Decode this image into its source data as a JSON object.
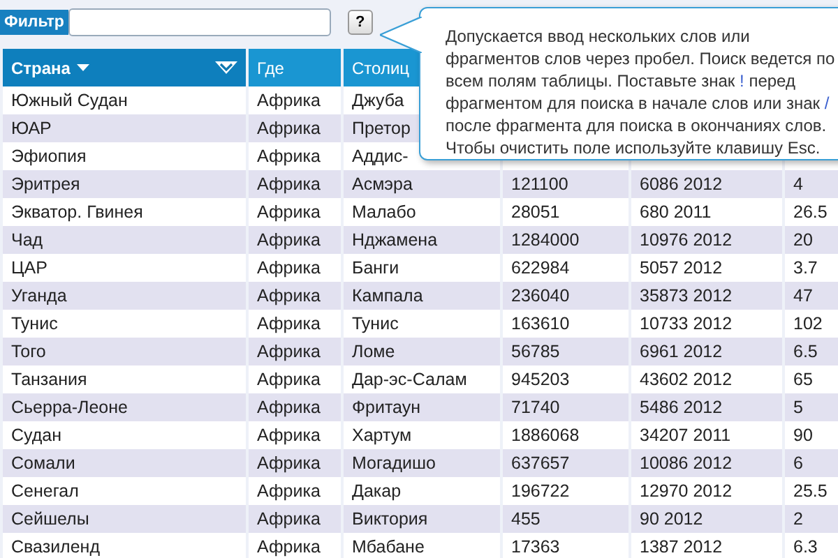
{
  "filter": {
    "label": "Фильтр",
    "help_button": "?"
  },
  "tooltip": {
    "parts": [
      {
        "kind": "plain",
        "text": "Допускается ввод нескольких слов или фрагментов слов через пробел. Поиск ведется по всем полям таблицы. Поставьте знак "
      },
      {
        "kind": "symbol",
        "text": "!"
      },
      {
        "kind": "plain",
        "text": " перед фрагментом для поиска в начале слов или знак "
      },
      {
        "kind": "symbol",
        "text": "/"
      },
      {
        "kind": "plain",
        "text": " после фрагмента для поиска в окончаниях слов. Чтобы очистить поле используйте клавишу Esc."
      }
    ]
  },
  "table": {
    "columns": [
      {
        "label": "Страна",
        "selected": true
      },
      {
        "label": "Где",
        "selected": false
      },
      {
        "label": "Столиц",
        "selected": false
      }
    ],
    "rows": [
      {
        "cells": [
          "Южный Судан",
          "Африка",
          "Джуба"
        ]
      },
      {
        "cells": [
          "ЮАР",
          "Африка",
          "Претор"
        ]
      },
      {
        "cells": [
          "Эфиопия",
          "Африка",
          "Аддис-"
        ]
      },
      {
        "cells": [
          "Эритрея",
          "Африка",
          "Асмэра",
          "121100",
          "6086 2012",
          "4"
        ]
      },
      {
        "cells": [
          "Экватор. Гвинея",
          "Африка",
          "Малабо",
          "28051",
          "680 2011",
          "26.5"
        ]
      },
      {
        "cells": [
          "Чад",
          "Африка",
          "Нджамена",
          "1284000",
          "10976 2012",
          "20"
        ]
      },
      {
        "cells": [
          "ЦАР",
          "Африка",
          "Банги",
          "622984",
          "5057 2012",
          "3.7"
        ]
      },
      {
        "cells": [
          "Уганда",
          "Африка",
          "Кампала",
          "236040",
          "35873 2012",
          "47"
        ]
      },
      {
        "cells": [
          "Тунис",
          "Африка",
          "Тунис",
          "163610",
          "10733 2012",
          "102"
        ]
      },
      {
        "cells": [
          "Того",
          "Африка",
          "Ломе",
          "56785",
          "6961 2012",
          "6.5"
        ]
      },
      {
        "cells": [
          "Танзания",
          "Африка",
          "Дар-эс-Салам",
          "945203",
          "43602 2012",
          "65"
        ]
      },
      {
        "cells": [
          "Сьерра-Леоне",
          "Африка",
          "Фритаун",
          "71740",
          "5486 2012",
          "5"
        ]
      },
      {
        "cells": [
          "Судан",
          "Африка",
          "Хартум",
          "1886068",
          "34207 2011",
          "90"
        ]
      },
      {
        "cells": [
          "Сомали",
          "Африка",
          "Могадишо",
          "637657",
          "10086 2012",
          "6"
        ]
      },
      {
        "cells": [
          "Сенегал",
          "Африка",
          "Дакар",
          "196722",
          "12970 2012",
          "25.5"
        ]
      },
      {
        "cells": [
          "Сейшелы",
          "Африка",
          "Виктория",
          "455",
          "90 2012",
          "2"
        ]
      },
      {
        "cells": [
          "Свазиленд",
          "Африка",
          "Мбабане",
          "17363",
          "1387 2012",
          "6.3"
        ]
      }
    ]
  }
}
